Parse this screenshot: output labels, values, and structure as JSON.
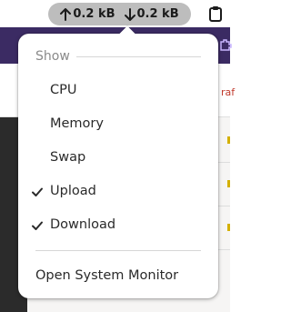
{
  "panel": {
    "upload_rate": "0.2 kB",
    "download_rate": "0.2 kB",
    "upload_icon": "arrow-up-icon",
    "download_icon": "arrow-down-icon",
    "clipboard_icon": "clipboard-icon"
  },
  "background": {
    "partial_text": "raf",
    "colors": {
      "header": "#3b2b63",
      "sidebar": "#2b2b2b"
    }
  },
  "menu": {
    "section_title": "Show",
    "items": [
      {
        "label": "CPU",
        "checked": false
      },
      {
        "label": "Memory",
        "checked": false
      },
      {
        "label": "Swap",
        "checked": false
      },
      {
        "label": "Upload",
        "checked": true
      },
      {
        "label": "Download",
        "checked": true
      }
    ],
    "monitor_label": "Open System Monitor"
  }
}
